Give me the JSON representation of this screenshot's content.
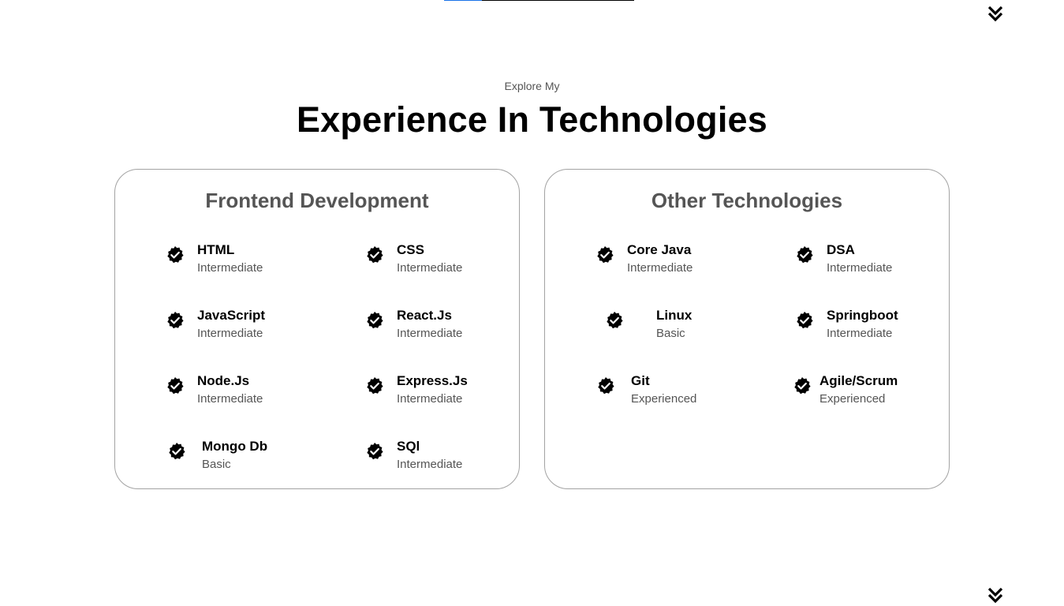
{
  "header": {
    "subtitle": "Explore My",
    "title": "Experience In Technologies"
  },
  "icons": {
    "scroll": "double-chevron-down-icon",
    "skill": "verified-check-icon"
  },
  "cards": [
    {
      "title": "Frontend Development",
      "skills": [
        {
          "name": "HTML",
          "level": "Intermediate"
        },
        {
          "name": "CSS",
          "level": "Intermediate"
        },
        {
          "name": "JavaScript",
          "level": "Intermediate"
        },
        {
          "name": "React.Js",
          "level": "Intermediate"
        },
        {
          "name": "Node.Js",
          "level": "Intermediate"
        },
        {
          "name": "Express.Js",
          "level": "Intermediate"
        },
        {
          "name": "Mongo Db",
          "level": "Basic"
        },
        {
          "name": "SQl",
          "level": "Intermediate"
        }
      ]
    },
    {
      "title": "Other Technologies",
      "skills": [
        {
          "name": "Core Java",
          "level": "Intermediate"
        },
        {
          "name": "DSA",
          "level": "Intermediate"
        },
        {
          "name": "Linux",
          "level": "Basic"
        },
        {
          "name": "Springboot",
          "level": "Intermediate"
        },
        {
          "name": "Git",
          "level": "Experienced"
        },
        {
          "name": "Agile/Scrum",
          "level": "Experienced"
        }
      ]
    }
  ]
}
